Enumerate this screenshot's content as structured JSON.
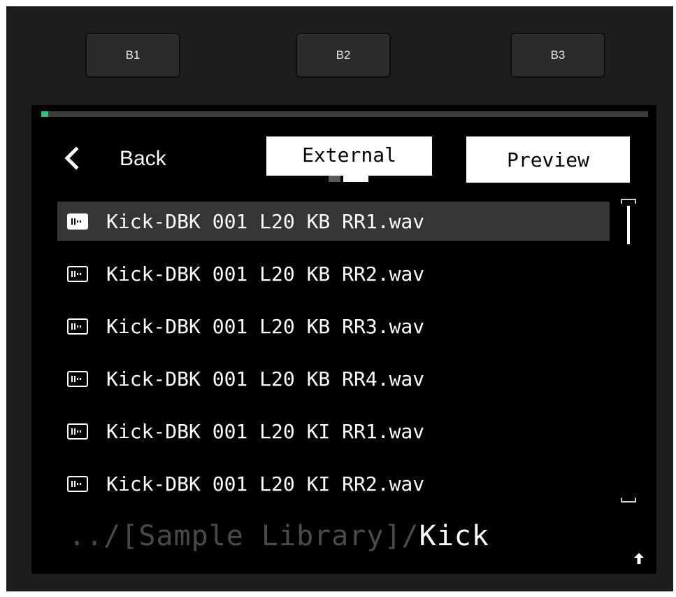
{
  "hardware_buttons": [
    {
      "label": "B1"
    },
    {
      "label": "B2"
    },
    {
      "label": "B3"
    }
  ],
  "progress": {
    "value": 0.012,
    "color": "#2ec27e"
  },
  "header": {
    "back_label": "Back",
    "source_tab": "External",
    "preview_label": "Preview",
    "page_indicator": {
      "pages": 2,
      "current": 2
    }
  },
  "files": [
    {
      "name": "Kick-DBK 001 L20 KB RR1.wav",
      "icon": "waveform-file-icon",
      "selected": true
    },
    {
      "name": "Kick-DBK 001 L20 KB RR2.wav",
      "icon": "waveform-file-icon",
      "selected": false
    },
    {
      "name": "Kick-DBK 001 L20 KB RR3.wav",
      "icon": "waveform-file-icon",
      "selected": false
    },
    {
      "name": "Kick-DBK 001 L20 KB RR4.wav",
      "icon": "waveform-file-icon",
      "selected": false
    },
    {
      "name": "Kick-DBK 001 L20 KI RR1.wav",
      "icon": "waveform-file-icon",
      "selected": false
    },
    {
      "name": "Kick-DBK 001 L20 KI RR2.wav",
      "icon": "waveform-file-icon",
      "selected": false
    }
  ],
  "path": {
    "parent": "../[Sample Library]/",
    "current": "Kick"
  },
  "colors": {
    "device_bg": "#1d1d1d",
    "screen_bg": "#000000",
    "selected_row": "#353535",
    "dim_text": "#4a4a4a"
  }
}
